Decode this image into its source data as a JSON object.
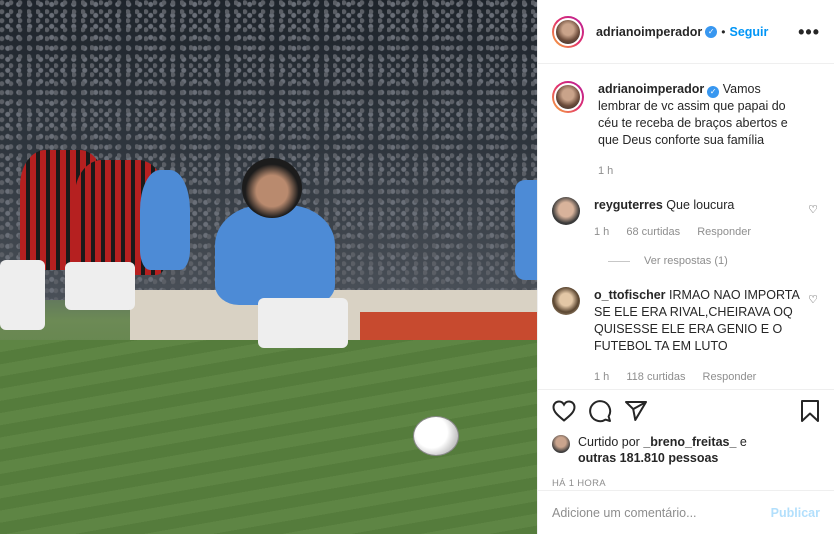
{
  "post": {
    "image_alt": "Foto de futebol",
    "author": "adrianoimperador",
    "follow_label": "Seguir",
    "more_label": "•••",
    "separator": "•",
    "caption": "Vamos lembrar de vc assim que papai do céu te receba de braços abertos e que Deus conforte sua família",
    "caption_time": "1 h"
  },
  "comments": [
    {
      "user": "reyguterres",
      "text": "Que loucura",
      "time": "1 h",
      "likes": "68 curtidas",
      "reply": "Responder",
      "view_replies": "Ver respostas (1)"
    },
    {
      "user": "o_ttofischer",
      "text": "IRMAO NAO IMPORTA SE ELE ERA RIVAL,CHEIRAVA OQ QUISESSE ELE ERA GENIO E O FUTEBOL TA EM LUTO",
      "time": "1 h",
      "likes": "118 curtidas",
      "reply": "Responder"
    }
  ],
  "likes": {
    "prefix": "Curtido por",
    "user": "_breno_freitas_",
    "connector": "e",
    "others": "outras 181.810 pessoas"
  },
  "timestamp": "HÁ 1 HORA",
  "add_comment": {
    "placeholder": "Adicione um comentário...",
    "publish": "Publicar"
  },
  "icons": {
    "like": "heart-icon",
    "comment": "comment-icon",
    "share": "share-icon",
    "save": "bookmark-icon",
    "verified": "verified-badge-icon"
  },
  "colors": {
    "link_blue": "#0095f6",
    "publish_disabled": "#b2dffc",
    "muted": "#8e8e8e",
    "verified": "#3897f0"
  }
}
